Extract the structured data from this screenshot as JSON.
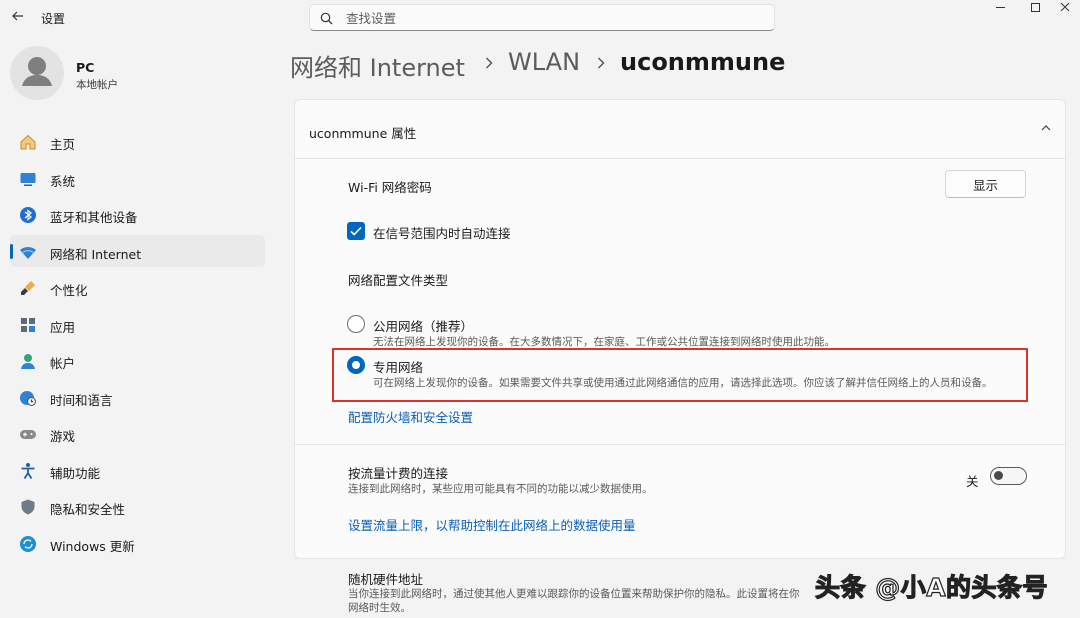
{
  "window": {
    "title": "设置"
  },
  "search": {
    "placeholder": "查找设置"
  },
  "profile": {
    "name": "PC",
    "account_type": "本地帐户"
  },
  "sidebar": {
    "items": [
      {
        "label": "主页",
        "icon": "home-icon"
      },
      {
        "label": "系统",
        "icon": "system-icon"
      },
      {
        "label": "蓝牙和其他设备",
        "icon": "bluetooth-icon"
      },
      {
        "label": "网络和 Internet",
        "icon": "wifi-icon",
        "active": true
      },
      {
        "label": "个性化",
        "icon": "brush-icon"
      },
      {
        "label": "应用",
        "icon": "apps-icon"
      },
      {
        "label": "帐户",
        "icon": "account-icon"
      },
      {
        "label": "时间和语言",
        "icon": "globe-clock-icon"
      },
      {
        "label": "游戏",
        "icon": "gamepad-icon"
      },
      {
        "label": "辅助功能",
        "icon": "accessibility-icon"
      },
      {
        "label": "隐私和安全性",
        "icon": "shield-icon"
      },
      {
        "label": "Windows 更新",
        "icon": "windows-update-icon"
      }
    ]
  },
  "breadcrumb": {
    "items": [
      "网络和 Internet",
      "WLAN",
      "uconmmune"
    ]
  },
  "properties": {
    "title": "uconmmune 属性",
    "wifi_password": {
      "label": "Wi-Fi 网络密码",
      "button": "显示"
    },
    "auto_connect": {
      "label": "在信号范围内时自动连接",
      "checked": true
    },
    "profile_type": {
      "heading": "网络配置文件类型",
      "options": [
        {
          "label": "公用网络（推荐）",
          "desc": "无法在网络上发现你的设备。在大多数情况下，在家庭、工作或公共位置连接到网络时使用此功能。",
          "selected": false
        },
        {
          "label": "专用网络",
          "desc": "可在网络上发现你的设备。如果需要文件共享或使用通过此网络通信的应用，请选择此选项。你应该了解并信任网络上的人员和设备。",
          "selected": true
        }
      ],
      "firewall_link": "配置防火墙和安全设置"
    },
    "metered": {
      "label": "按流量计费的连接",
      "desc": "连接到此网络时，某些应用可能具有不同的功能以减少数据使用。",
      "state": "关",
      "link": "设置流量上限，以帮助控制在此网络上的数据使用量"
    },
    "random_mac": {
      "label": "随机硬件地址",
      "desc_line1": "当你连接到此网络时，通过使其他人更难以跟踪你的设备位置来帮助保护你的隐私。此设置将在你",
      "desc_line2": "网络时生效。"
    }
  },
  "watermark": "头条 @小A的头条号",
  "colors": {
    "accent": "#0067c0",
    "highlight_box": "#e0312b",
    "link": "#0a5fb5"
  }
}
